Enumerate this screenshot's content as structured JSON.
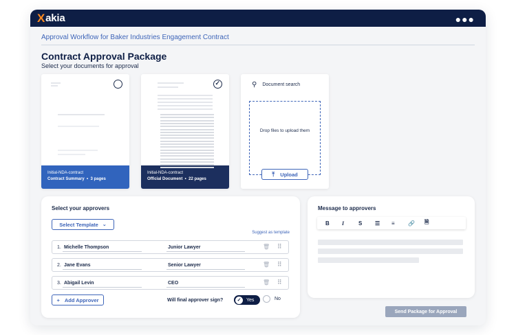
{
  "app": {
    "logo_mark": "X",
    "logo_text": "akia",
    "menu_icon": "more-dots-icon"
  },
  "breadcrumb": "Approval Workflow for Baker Industries Engagement Contract",
  "page": {
    "title": "Contract Approval Package",
    "subtitle": "Select your documents for approval"
  },
  "documents": [
    {
      "name": "Initial-NDA-contract",
      "type": "Contract Summary",
      "pages": "3 pages",
      "selected": false,
      "footer_color": "#3164bd"
    },
    {
      "name": "Initial-NDA-contract",
      "type": "Official Document",
      "pages": "22 pages",
      "selected": true,
      "footer_color": "#1c2f5e"
    }
  ],
  "upload": {
    "search_placeholder": "Document search",
    "drop_hint": "Drop files to upload them",
    "upload_label": "Upload"
  },
  "approvers": {
    "title": "Select your approvers",
    "template_button": "Select Template",
    "suggest_link": "Suggest as template",
    "rows": [
      {
        "num": "1.",
        "name": "Michelle Thompson",
        "role": "Junior Lawyer"
      },
      {
        "num": "2.",
        "name": "Jane Evans",
        "role": "Senior Lawyer"
      },
      {
        "num": "3.",
        "name": "Abigail Levin",
        "role": "CEO"
      }
    ],
    "add_button": "Add Approver",
    "sign_question": "Will final approver sign?",
    "yes_label": "Yes",
    "no_label": "No",
    "sign_selected": "Yes"
  },
  "message": {
    "title": "Message to approvers",
    "toolbar": [
      {
        "label": "B",
        "icon": "bold-icon"
      },
      {
        "label": "I",
        "icon": "italic-icon"
      },
      {
        "label": "S",
        "icon": "strikethrough-icon"
      },
      {
        "label": "⒈≡",
        "icon": "numbered-list-icon"
      },
      {
        "label": "•≡",
        "icon": "bullet-list-icon"
      },
      {
        "label": "🔗",
        "icon": "link-icon"
      },
      {
        "label": "📄",
        "icon": "attachment-icon"
      }
    ]
  },
  "send_button": "Send Package for Approval",
  "colors": {
    "navy": "#0e1e45",
    "accent": "#3d64b8",
    "orange": "#ff8a1f",
    "disabled": "#9aa6bc"
  }
}
